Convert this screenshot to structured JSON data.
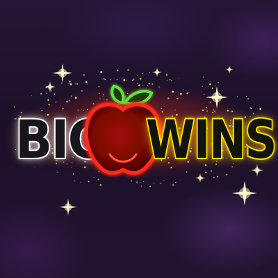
{
  "logo": {
    "word_left": "BIG",
    "word_right": "WINS",
    "apple_icon": "apple-icon"
  },
  "colors": {
    "left_word_outline": "#ffffff",
    "right_word_outline": "#f6e200",
    "apple_outline": "#ff2a1a",
    "leaf": "#5ad12e",
    "background": "#1a1026",
    "sparkle": "#ffd84a"
  }
}
